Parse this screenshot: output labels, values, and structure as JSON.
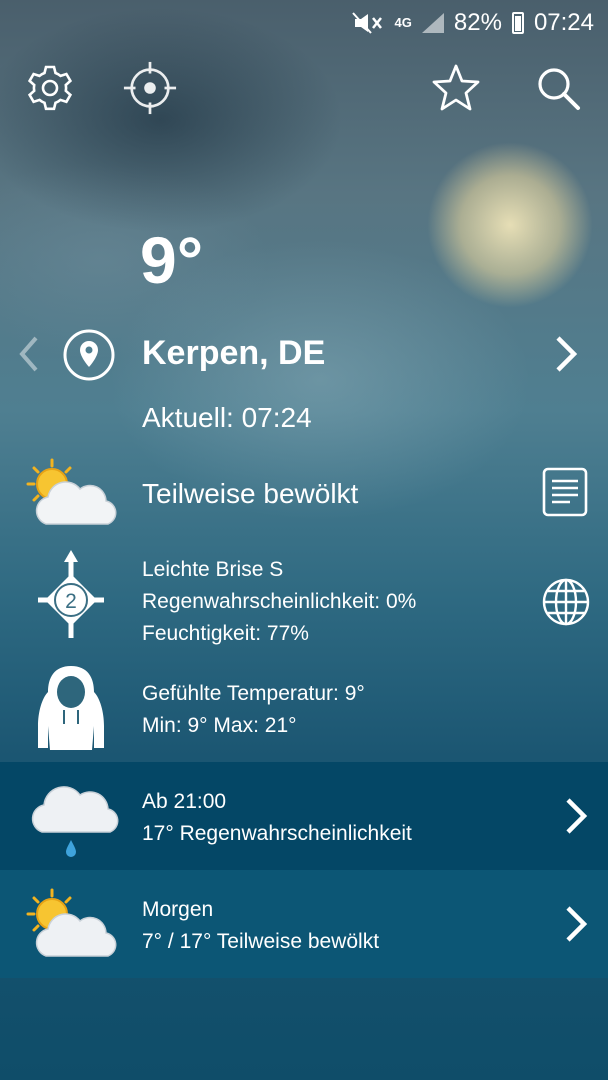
{
  "status_bar": {
    "network": "4G",
    "battery": "82%",
    "time": "07:24"
  },
  "icons": {
    "settings": "gear-icon",
    "locate": "crosshair-icon",
    "favorite": "star-icon",
    "search": "search-icon"
  },
  "current": {
    "temperature": "9°",
    "location": "Kerpen, DE",
    "updated": "Aktuell: 07:24",
    "condition": "Teilweise bewölkt",
    "wind": "Leichte Brise S",
    "wind_speed": "2",
    "rain_chance": "Regenwahrscheinlichkeit: 0%",
    "humidity": "Feuchtigkeit: 77%",
    "feels_like": "Gefühlte Temperatur: 9°",
    "min_max": "Min: 9° Max: 21°"
  },
  "forecast": [
    {
      "title": "Ab 21:00",
      "detail": "17° Regenwahrscheinlichkeit",
      "icon": "rain-cloud-icon"
    },
    {
      "title": "Morgen",
      "detail": "7° / 17° Teilweise bewölkt",
      "icon": "partly-cloudy-icon"
    }
  ],
  "colors": {
    "band_today": "#044766",
    "band_tomorrow": "#0c5675",
    "background_bottom": "#0a4a66"
  }
}
